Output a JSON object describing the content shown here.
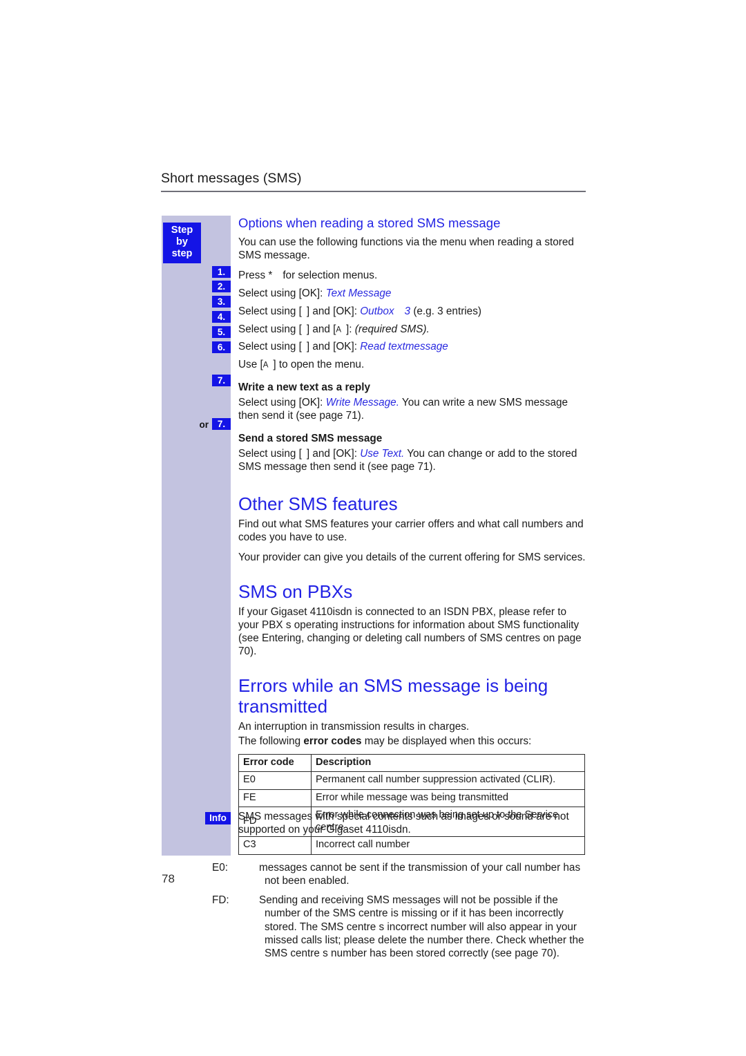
{
  "page": {
    "running_head": "Short messages (SMS)",
    "folio": "78",
    "accent_color": "#2222e4",
    "badge_color": "#1414e6",
    "sidebar_color": "#c3c3e0"
  },
  "sidebar": {
    "title_badge": "Step\nby\nstep",
    "title_lines": [
      "Step",
      "by",
      "step"
    ],
    "info_badge": "Info",
    "or_label": "or",
    "step_numbers": [
      "1.",
      "2.",
      "3.",
      "4.",
      "5.",
      "6.",
      "7.",
      "7."
    ]
  },
  "sections": {
    "options": {
      "heading": "Options when reading a stored SMS message",
      "intro": "You can use the following functions via the menu when reading a stored SMS message.",
      "steps": [
        {
          "num": "1.",
          "pre": "Press *",
          "post": "for selection menus."
        },
        {
          "num": "2.",
          "pre": "Select using [OK]: ",
          "menu": "Text Message",
          "post": ""
        },
        {
          "num": "3.",
          "pre": "Select using [",
          "mid": "] and [OK]: ",
          "menu": "Outbox",
          "menu2": "3",
          "post": "(e.g. 3 entries)"
        },
        {
          "num": "4.",
          "pre": "Select using [",
          "mid": "] and [",
          "key": "A",
          "mid2": "]: ",
          "italic": "(required SMS)."
        },
        {
          "num": "5.",
          "pre": "Select using [",
          "mid": "] and [OK]: ",
          "menu": "Read textmessage"
        },
        {
          "num": "6.",
          "pre": "Use [",
          "key": "A",
          "post": "] to open the menu."
        }
      ],
      "reply": {
        "heading": "Write a new text as a reply",
        "num": "7.",
        "pre": "Select using [OK]: ",
        "menu": "Write Message.",
        "post": " You can write a new SMS message then send it (see page 71)."
      },
      "stored": {
        "heading": "Send a stored SMS message",
        "num": "7.",
        "or": "or",
        "pre": "Select using [",
        "mid": "] and [OK]: ",
        "menu": "Use Text.",
        "post": " You can change or add to the stored SMS message then send it (see page 71)."
      }
    },
    "other_features": {
      "heading": "Other SMS features",
      "para1": "Find out what SMS features your carrier offers and what call numbers and codes you have to use.",
      "para2": "Your provider can give you details of the current offering for SMS services."
    },
    "pbx": {
      "heading": "SMS on PBXs",
      "para1": "If your Gigaset 4110isdn is connected to an ISDN PBX, please refer to your PBX s operating instructions for information about SMS functionality (see  Entering, changing or deleting call numbers of SMS centres  on page 70)."
    },
    "errors": {
      "heading": "Errors while an SMS message is being transmitted",
      "para1": "An interruption in transmission results in charges.",
      "para2_pre": "The following ",
      "para2_bold": "error codes",
      "para2_post": " may be displayed when this occurs:",
      "table": {
        "headers": [
          "Error code",
          "Description"
        ],
        "rows": [
          [
            "E0",
            "Permanent call number suppression activated (CLIR)."
          ],
          [
            "FE",
            "Error while  message was being transmitted"
          ],
          [
            "FD",
            "Error while connection was being set up to the Service centre"
          ],
          [
            "C3",
            "Incorrect  call number"
          ]
        ]
      },
      "notes": [
        {
          "label": "E0:",
          "text": "messages cannot be sent if the transmission of your call number has not been enabled."
        },
        {
          "label": "FD:",
          "text": "Sending and receiving SMS messages will not be possible if the number of the SMS centre is missing or if it has been incorrectly stored. The SMS centre s incorrect number will also appear in your missed calls list; please delete the number there. Check whether the SMS centre s number has been stored correctly (see page 70)."
        }
      ]
    },
    "info": {
      "text": "SMS messages with special contents such as images or sound are not supported on your Gigaset 4110isdn."
    }
  }
}
